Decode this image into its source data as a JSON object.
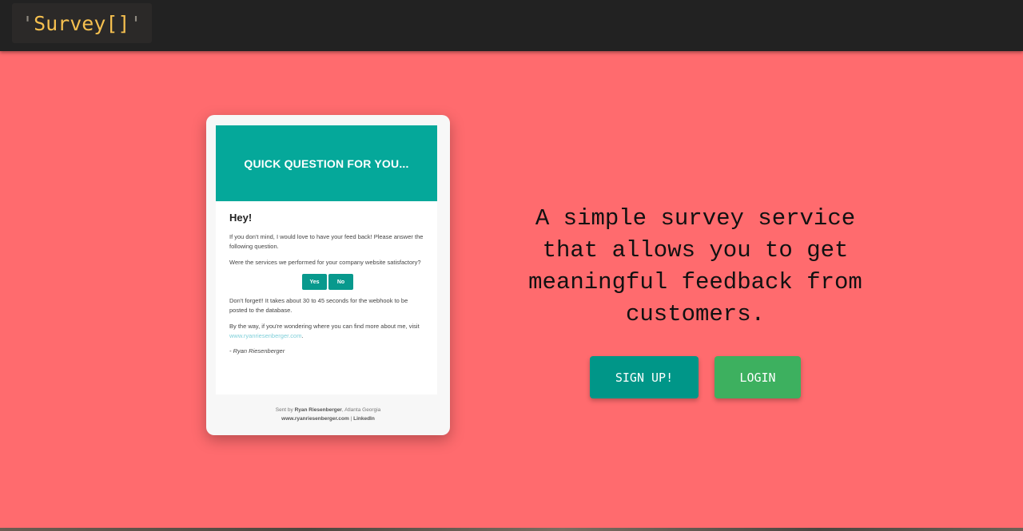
{
  "navbar": {
    "brand_quote_open": "'",
    "brand_text": "Survey[]",
    "brand_quote_close": "'"
  },
  "preview": {
    "banner_title": "QUICK QUESTION FOR YOU...",
    "greeting": "Hey!",
    "intro": "If you don't mind, I would love to have your feed back! Please answer the following question.",
    "question": "Were the services we performed for your company website satisfactory?",
    "yes_label": "Yes",
    "no_label": "No",
    "reminder": "Don't forget!! It takes about 30 to 45 seconds for the webhook to be posted to the database.",
    "more_info_prefix": "By the way, if you're wondering where you can find more about me, visit ",
    "more_info_link": "www.ryanriesenberger.com",
    "more_info_suffix": ".",
    "signature": "- Ryan Riesenberger",
    "footer_prefix": "Sent by ",
    "footer_name": "Ryan Riesenberger",
    "footer_location": ", Atlanta Georgia",
    "footer_site": "www.ryanriesenberger.com",
    "footer_separator": " | ",
    "footer_linkedin": "LinkedIn"
  },
  "hero": {
    "tagline": "A simple survey service that allows you to get meaningful feedback from customers.",
    "signup_label": "SIGN UP!",
    "login_label": "LOGIN"
  },
  "colors": {
    "navbar_bg": "#222222",
    "brand_text": "#f6c04f",
    "hero_bg": "#ff6b6e",
    "banner": "#05a89a",
    "signup_bg": "#009688",
    "login_bg": "#3db05f"
  }
}
